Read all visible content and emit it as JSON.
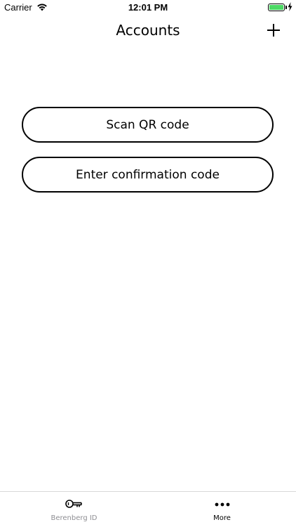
{
  "status_bar": {
    "carrier": "Carrier",
    "time": "12:01 PM",
    "battery_color": "#4cd964"
  },
  "nav": {
    "title": "Accounts",
    "add_icon": "plus-icon"
  },
  "actions": {
    "scan_label": "Scan QR code",
    "enter_label": "Enter confirmation code"
  },
  "tab_bar": {
    "tabs": [
      {
        "label": "Berenberg ID",
        "icon": "key-icon",
        "active": false
      },
      {
        "label": "More",
        "icon": "more-icon",
        "active": true
      }
    ]
  },
  "colors": {
    "inactive_tab": "#8e8e93",
    "active_tab": "#000000"
  }
}
